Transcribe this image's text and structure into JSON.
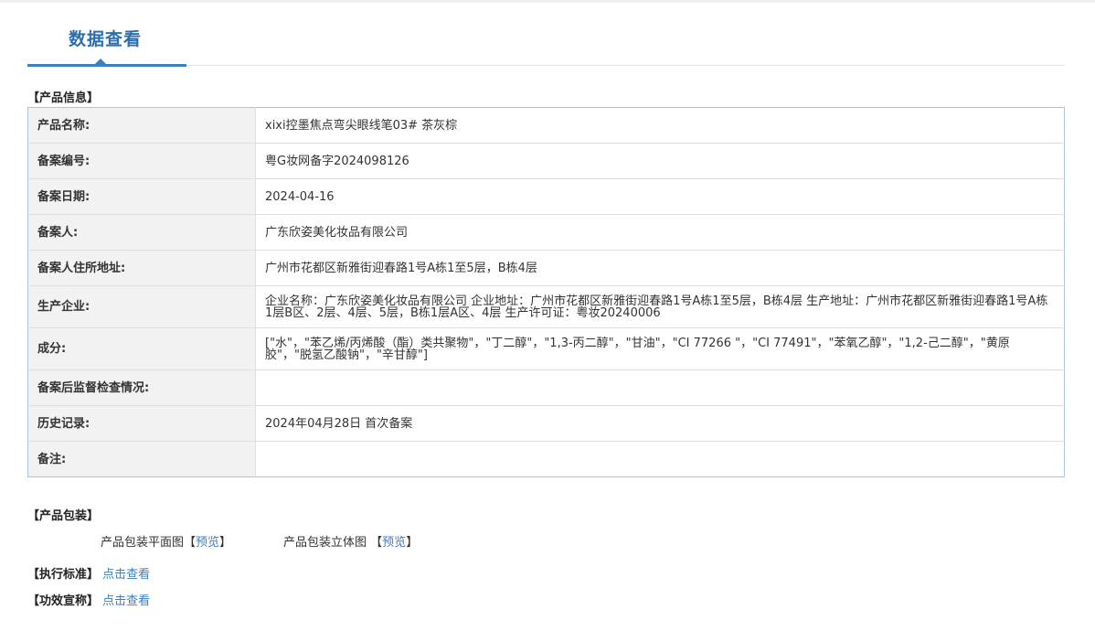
{
  "page": {
    "title": "数据查看"
  },
  "product_info": {
    "heading": "【产品信息】",
    "rows": [
      {
        "label": "产品名称:",
        "value": "xixi控墨焦点弯尖眼线笔03# 茶灰棕"
      },
      {
        "label": "备案编号:",
        "value": "粤G妆网备字2024098126"
      },
      {
        "label": "备案日期:",
        "value": "2024-04-16"
      },
      {
        "label": "备案人:",
        "value": "广东欣姿美化妆品有限公司"
      },
      {
        "label": "备案人住所地址:",
        "value": "广州市花都区新雅街迎春路1号A栋1至5层，B栋4层"
      },
      {
        "label": "生产企业:",
        "value": "企业名称：广东欣姿美化妆品有限公司 企业地址：广州市花都区新雅街迎春路1号A栋1至5层，B栋4层 生产地址：广州市花都区新雅街迎春路1号A栋1层B区、2层、4层、5层，B栋1层A区、4层 生产许可证：粤妆20240006"
      },
      {
        "label": "成分:",
        "value": "[\"水\"，\"苯乙烯/丙烯酸（酯）类共聚物\"，\"丁二醇\"，\"1,3-丙二醇\"，\"甘油\"，\"CI 77266 \"，\"CI 77491\"，\"苯氧乙醇\"，\"1,2-己二醇\"，\"黄原胶\"，\"脱氢乙酸钠\"，\"辛甘醇\"]"
      },
      {
        "label": "备案后监督检查情况:",
        "value": ""
      },
      {
        "label": "历史记录:",
        "value": "2024年04月28日 首次备案"
      },
      {
        "label": "备注:",
        "value": ""
      }
    ]
  },
  "packaging": {
    "heading": "【产品包装】",
    "flat_label": "产品包装平面图",
    "threed_label": "产品包装立体图",
    "bracket_open": "【",
    "bracket_close": "】",
    "preview_link": "预览"
  },
  "standard": {
    "label": "【执行标准】",
    "link": "点击查看"
  },
  "efficacy": {
    "label": "【功效宣称】",
    "link": "点击查看"
  },
  "colors": {
    "title_blue": "#2d6fad",
    "link_blue": "#3a7fc4",
    "table_border": "#a9c5e0",
    "label_bg": "#f2f2f2"
  }
}
